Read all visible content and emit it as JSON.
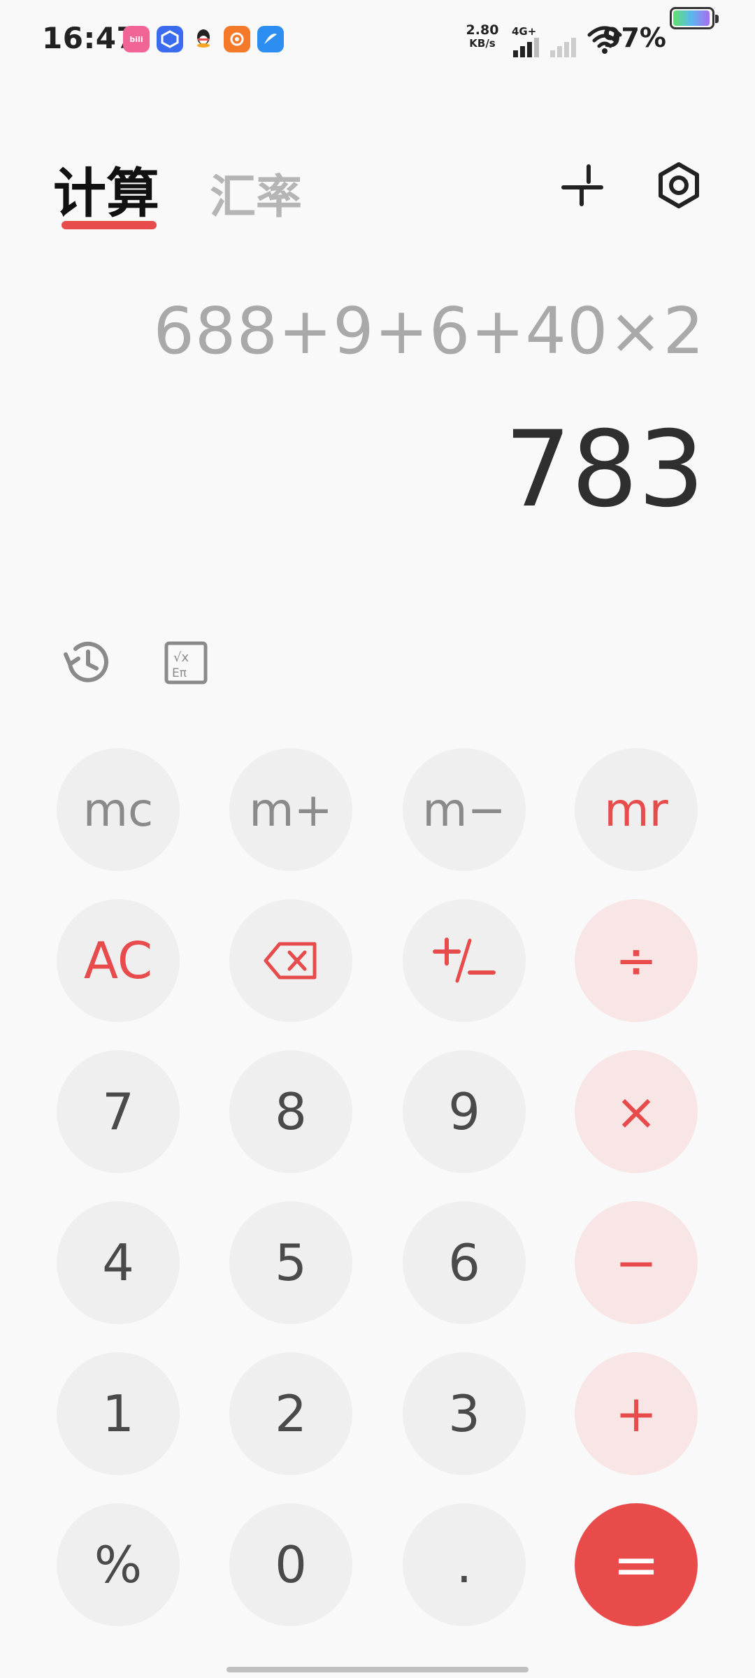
{
  "status_bar": {
    "time": "16:47",
    "net_speed_value": "2.80",
    "net_speed_unit": "KB/s",
    "network_type": "4G+",
    "battery_percent": "97%",
    "battery_level": 0.97,
    "app_icons": [
      "bilibili-icon",
      "blue-app-icon",
      "qq-icon",
      "orange-app-icon",
      "lightblue-app-icon"
    ],
    "bili_label": "bili"
  },
  "header": {
    "tabs": [
      {
        "label": "计算",
        "active": true
      },
      {
        "label": "汇率",
        "active": false
      }
    ],
    "accent_color": "#e84b4b"
  },
  "display": {
    "expression": "688+9+6+40×2",
    "result": "783"
  },
  "keypad": {
    "rows": [
      [
        "mc",
        "m+",
        "m−",
        "mr"
      ],
      [
        "AC",
        "backspace",
        "+/−",
        "÷"
      ],
      [
        "7",
        "8",
        "9",
        "×"
      ],
      [
        "4",
        "5",
        "6",
        "−"
      ],
      [
        "1",
        "2",
        "3",
        "+"
      ],
      [
        "%",
        "0",
        ".",
        "="
      ]
    ]
  },
  "labels": {
    "mc": "mc",
    "mplus": "m+",
    "mminus": "m−",
    "mr": "mr",
    "ac": "AC",
    "divide": "÷",
    "seven": "7",
    "eight": "8",
    "nine": "9",
    "multiply": "×",
    "four": "4",
    "five": "5",
    "six": "6",
    "minus": "−",
    "one": "1",
    "two": "2",
    "three": "3",
    "plus": "+",
    "percent": "%",
    "zero": "0",
    "dot": ".",
    "equals": "="
  }
}
